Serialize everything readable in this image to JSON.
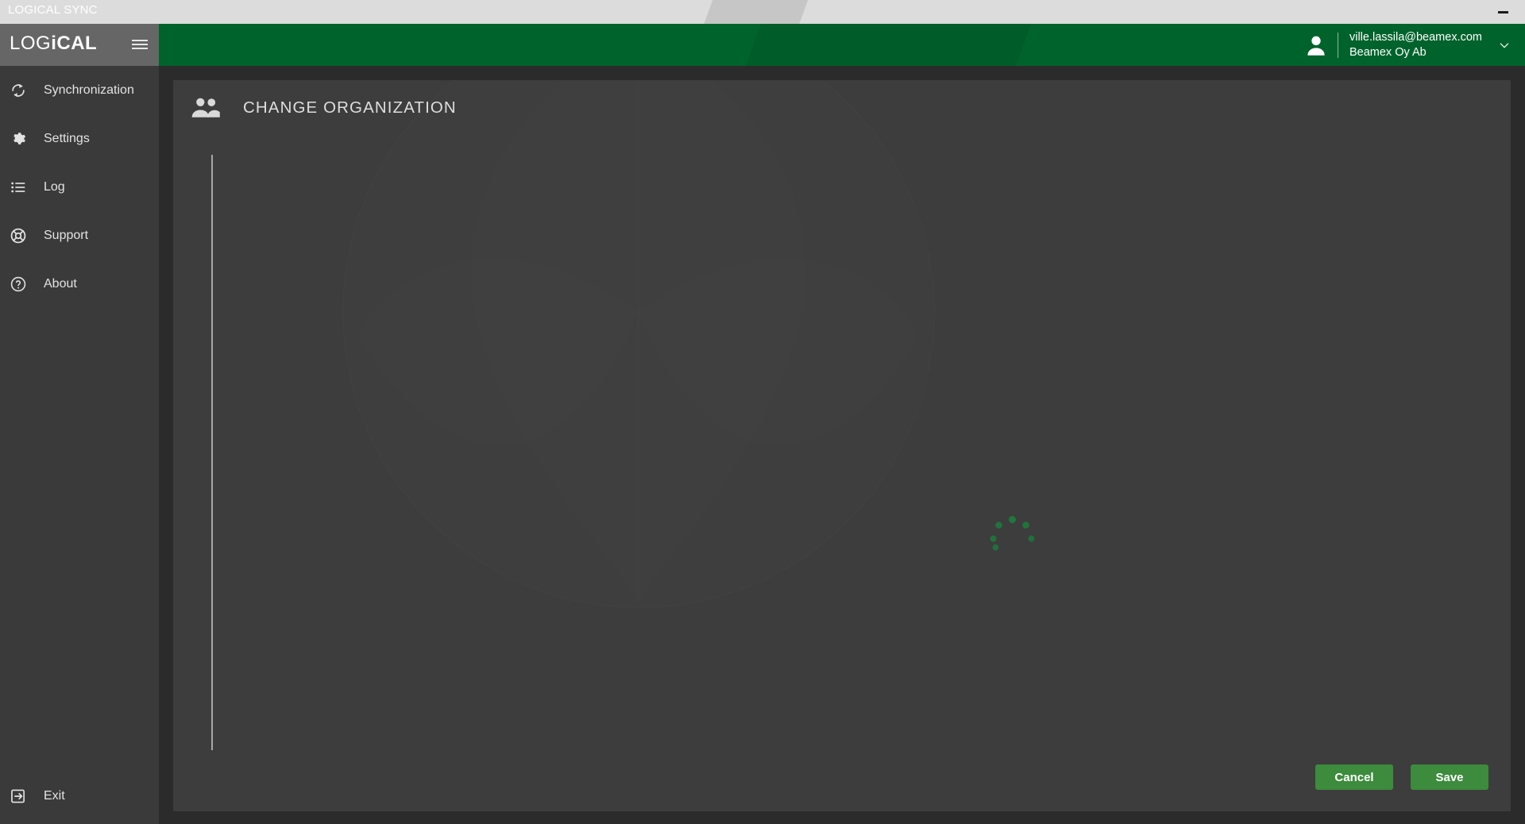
{
  "window": {
    "title": "LOGICAL SYNC",
    "minimize_label": "Minimize"
  },
  "brand": {
    "logo_part1": "LOG",
    "logo_part2": "i",
    "logo_part3": "CAL",
    "menu_icon": "hamburger-icon"
  },
  "topbar": {
    "user_email": "ville.lassila@beamex.com",
    "user_org": "Beamex Oy Ab",
    "avatar_icon": "user-avatar-icon",
    "chevron_icon": "chevron-down-icon",
    "background_color": "#00632c"
  },
  "sidebar": {
    "background_color": "#3a3a3a",
    "items": [
      {
        "label": "Synchronization",
        "icon": "sync-icon"
      },
      {
        "label": "Settings",
        "icon": "gear-icon"
      },
      {
        "label": "Log",
        "icon": "list-icon"
      },
      {
        "label": "Support",
        "icon": "lifebuoy-icon"
      },
      {
        "label": "About",
        "icon": "question-circle-icon"
      }
    ],
    "exit": {
      "label": "Exit",
      "icon": "exit-icon"
    }
  },
  "main": {
    "page_title": "CHANGE ORGANIZATION",
    "page_icon": "group-people-icon",
    "loading": true,
    "spinner_color": "#1c7a3c",
    "background_color": "#3d3d3d"
  },
  "footer": {
    "cancel_label": "Cancel",
    "save_label": "Save",
    "button_color": "#3d8b3d"
  }
}
